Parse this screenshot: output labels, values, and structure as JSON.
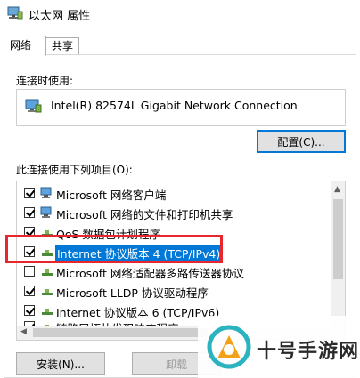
{
  "window": {
    "title": "以太网 属性"
  },
  "tabs": [
    {
      "label": "网络",
      "active": true
    },
    {
      "label": "共享",
      "active": false
    }
  ],
  "connect_using": {
    "label": "连接时使用:",
    "adapter_name": "Intel(R) 82574L Gigabit Network Connection",
    "adapter_icon": "network-adapter-icon",
    "configure_button": "配置(C)..."
  },
  "items_section": {
    "label": "此连接使用下列项目(O):",
    "items": [
      {
        "label": "Microsoft 网络客户端",
        "checked": true,
        "icon": "network-client-icon",
        "selected": false
      },
      {
        "label": "Microsoft 网络的文件和打印机共享",
        "checked": true,
        "icon": "network-share-icon",
        "selected": false
      },
      {
        "label": "QoS 数据包计划程序",
        "checked": true,
        "icon": "qos-icon",
        "selected": false
      },
      {
        "label": "Internet 协议版本 4 (TCP/IPv4)",
        "checked": true,
        "icon": "protocol-icon",
        "selected": true
      },
      {
        "label": "Microsoft 网络适配器多路传送器协议",
        "checked": false,
        "icon": "protocol-icon",
        "selected": false
      },
      {
        "label": "Microsoft LLDP 协议驱动程序",
        "checked": true,
        "icon": "protocol-icon",
        "selected": false
      },
      {
        "label": "Internet 协议版本 6 (TCP/IPv6)",
        "checked": true,
        "icon": "protocol-icon",
        "selected": false
      },
      {
        "label": "链路层拓扑发现响应程序",
        "checked": true,
        "icon": "protocol-icon",
        "selected": false
      }
    ]
  },
  "buttons": {
    "install": "安装(N)...",
    "uninstall": "卸载"
  },
  "watermark": {
    "text": "十号手游网"
  },
  "colors": {
    "selection": "#0078d7",
    "highlight_frame": "#e8262e"
  }
}
